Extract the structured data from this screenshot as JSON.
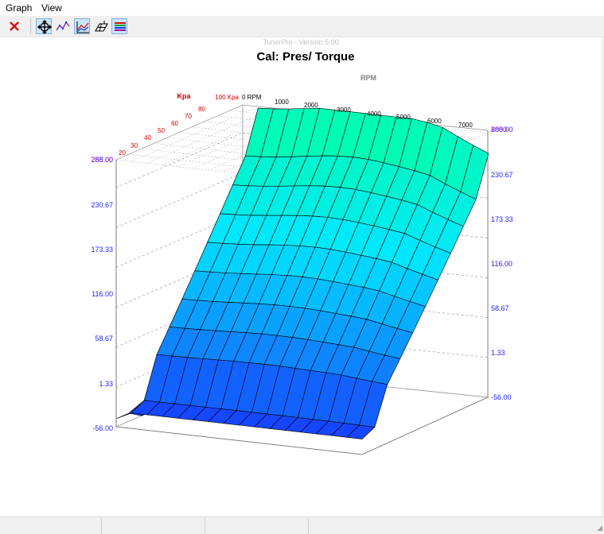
{
  "menu": {
    "graph": "Graph",
    "view": "View"
  },
  "toolbar": {
    "buttons": [
      {
        "name": "close-graph-button",
        "icon": "red-x-icon"
      },
      {
        "name": "rotate-button",
        "icon": "move-crosshair-icon",
        "pressed": true
      },
      {
        "name": "scatter-mode-button",
        "icon": "scatter-line-icon",
        "pressed": false
      },
      {
        "name": "graph-mode-button",
        "icon": "line-graph-icon",
        "pressed": true
      },
      {
        "name": "surface-mode-button",
        "icon": "surface-icon",
        "pressed": false
      },
      {
        "name": "colors-button",
        "icon": "color-bars-icon",
        "pressed": true
      }
    ]
  },
  "graph": {
    "watermark": "TunerPro - Version 5.00",
    "title": "Cal: Pres/ Torque",
    "rpm_axis_title": "RPM",
    "kpa_axis_title": "Kpa",
    "kpa_ticks": [
      "20",
      "30",
      "40",
      "50",
      "60",
      "70",
      "80",
      "100 Kpa"
    ],
    "rpm_ticks": [
      "0 RPM",
      "1000",
      "2000",
      "3000",
      "4000",
      "5000",
      "6000",
      "7000",
      "8000"
    ],
    "left_z_ticks": [
      "288.00",
      "230.67",
      "173.33",
      "116.00",
      "58.67",
      "1.33",
      "-56.00"
    ],
    "left_z_overlap": "255.00",
    "right_z_ticks": [
      "288.00",
      "230.67",
      "173.33",
      "116.00",
      "58.67",
      "1.33",
      "-56.00"
    ],
    "right_z_overlap": "8000"
  },
  "colors": {
    "low": "#1a30ff",
    "high": "#00ffa8",
    "tick_blue": "#1c1cff",
    "kpa_red": "#d40000",
    "title_gray": "#808080"
  }
}
